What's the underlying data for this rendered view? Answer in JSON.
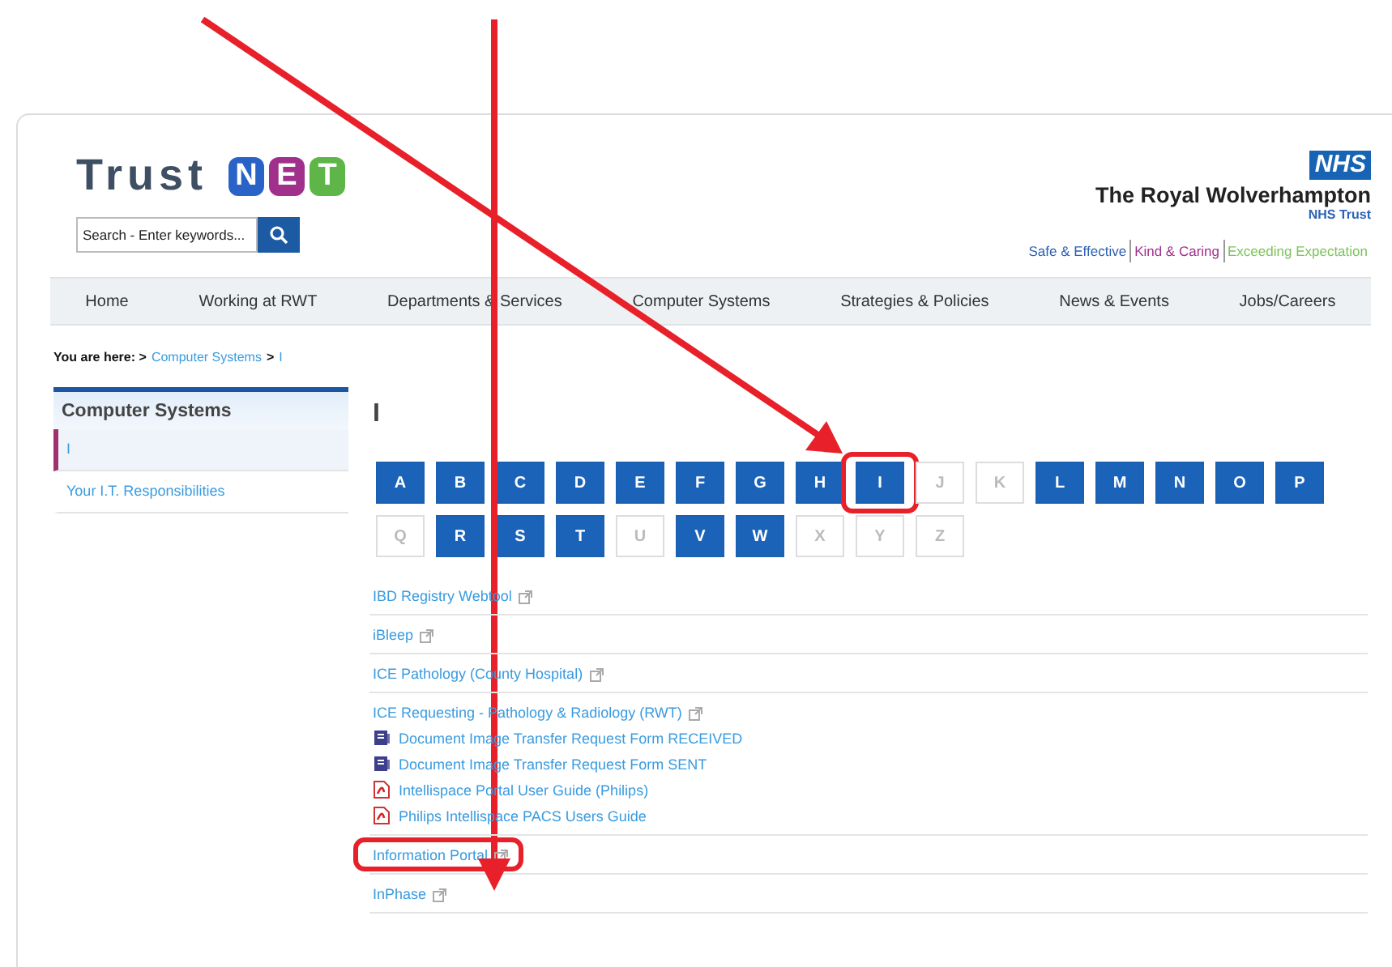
{
  "logo": {
    "word": "Trust",
    "letters": [
      {
        "char": "N",
        "color": "#2a63c8"
      },
      {
        "char": "E",
        "color": "#a0308c"
      },
      {
        "char": "T",
        "color": "#5fb648"
      }
    ]
  },
  "search": {
    "placeholder": "Search - Enter keywords..."
  },
  "org": {
    "badge": "NHS",
    "name": "The Royal Wolverhampton",
    "sub": "NHS Trust",
    "values": [
      {
        "text": "Safe & Effective",
        "color": "#2c5fb3"
      },
      {
        "text": "Kind & Caring",
        "color": "#a0308c"
      },
      {
        "text": "Exceeding Expectation",
        "color": "#7cc35a"
      }
    ]
  },
  "nav": [
    "Home",
    "Working at RWT",
    "Departments & Services",
    "Computer Systems",
    "Strategies & Policies",
    "News & Events",
    "Jobs/Careers"
  ],
  "breadcrumb": {
    "label": "You are here: >",
    "items": [
      "Computer Systems",
      "I"
    ],
    "separator": ">"
  },
  "sidebar": {
    "title": "Computer Systems",
    "items": [
      {
        "label": "I",
        "selected": true
      },
      {
        "label": "Your I.T. Responsibilities",
        "selected": false
      }
    ]
  },
  "heading": "I",
  "letters": [
    {
      "char": "A",
      "disabled": false,
      "highlighted": false
    },
    {
      "char": "B",
      "disabled": false,
      "highlighted": false
    },
    {
      "char": "C",
      "disabled": false,
      "highlighted": false
    },
    {
      "char": "D",
      "disabled": false,
      "highlighted": false
    },
    {
      "char": "E",
      "disabled": false,
      "highlighted": false
    },
    {
      "char": "F",
      "disabled": false,
      "highlighted": false
    },
    {
      "char": "G",
      "disabled": false,
      "highlighted": false
    },
    {
      "char": "H",
      "disabled": false,
      "highlighted": false
    },
    {
      "char": "I",
      "disabled": false,
      "highlighted": true
    },
    {
      "char": "J",
      "disabled": true,
      "highlighted": false
    },
    {
      "char": "K",
      "disabled": true,
      "highlighted": false
    },
    {
      "char": "L",
      "disabled": false,
      "highlighted": false
    },
    {
      "char": "M",
      "disabled": false,
      "highlighted": false
    },
    {
      "char": "N",
      "disabled": false,
      "highlighted": false
    },
    {
      "char": "O",
      "disabled": false,
      "highlighted": false
    },
    {
      "char": "P",
      "disabled": false,
      "highlighted": false
    },
    {
      "char": "Q",
      "disabled": true,
      "highlighted": false
    },
    {
      "char": "R",
      "disabled": false,
      "highlighted": false
    },
    {
      "char": "S",
      "disabled": false,
      "highlighted": false
    },
    {
      "char": "T",
      "disabled": false,
      "highlighted": false
    },
    {
      "char": "U",
      "disabled": true,
      "highlighted": false
    },
    {
      "char": "V",
      "disabled": false,
      "highlighted": false
    },
    {
      "char": "W",
      "disabled": false,
      "highlighted": false
    },
    {
      "char": "X",
      "disabled": true,
      "highlighted": false
    },
    {
      "char": "Y",
      "disabled": true,
      "highlighted": false
    },
    {
      "char": "Z",
      "disabled": true,
      "highlighted": false
    }
  ],
  "entries": [
    {
      "title": "IBD Registry Webtool",
      "highlighted": false
    },
    {
      "title": "iBleep",
      "highlighted": false
    },
    {
      "title": "ICE Pathology (County Hospital)",
      "highlighted": false
    },
    {
      "title": "ICE Requesting - Pathology & Radiology (RWT)",
      "highlighted": false,
      "files": [
        {
          "name": "Document Image Transfer Request Form RECEIVED",
          "kind": "document"
        },
        {
          "name": "Document Image Transfer Request Form SENT",
          "kind": "document"
        },
        {
          "name": "Intellispace Portal User Guide (Philips)",
          "kind": "pdf"
        },
        {
          "name": "Philips Intellispace PACS Users Guide",
          "kind": "pdf"
        }
      ]
    },
    {
      "title": "Information Portal",
      "highlighted": true
    },
    {
      "title": "InPhase",
      "highlighted": false
    }
  ]
}
